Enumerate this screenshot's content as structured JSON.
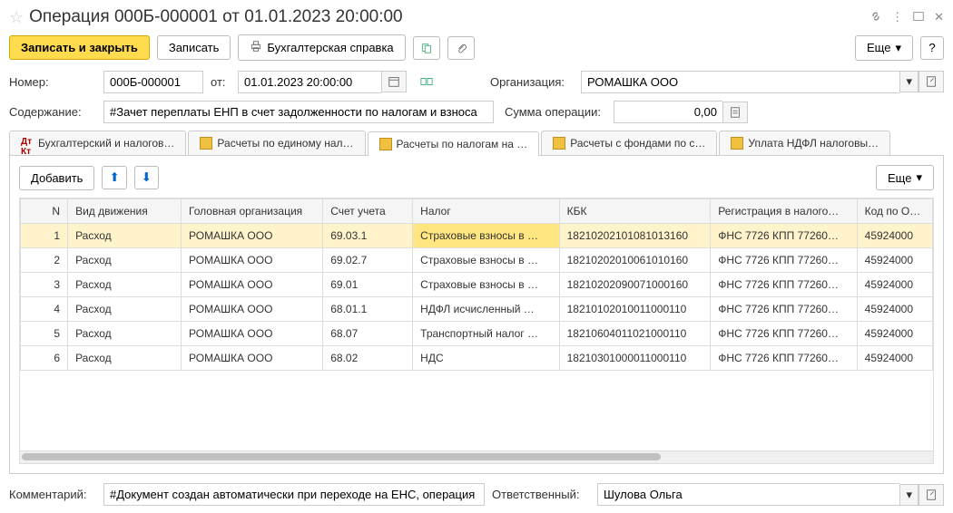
{
  "title": "Операция 000Б-000001 от 01.01.2023 20:00:00",
  "toolbar": {
    "save_close": "Записать и закрыть",
    "save": "Записать",
    "acc_ref": "Бухгалтерская справка",
    "more": "Еще"
  },
  "form": {
    "number_label": "Номер:",
    "number_value": "000Б-000001",
    "from_label": "от:",
    "date_value": "01.01.2023 20:00:00",
    "org_label": "Организация:",
    "org_value": "РОМАШКА ООО",
    "content_label": "Содержание:",
    "content_value": "#Зачет переплаты ЕНП в счет задолженности по налогам и взноса",
    "sum_label": "Сумма операции:",
    "sum_value": "0,00"
  },
  "tabs": [
    {
      "label": "Бухгалтерский и налогов…"
    },
    {
      "label": "Расчеты по единому нал…"
    },
    {
      "label": "Расчеты по налогам на …"
    },
    {
      "label": "Расчеты с фондами по с…"
    },
    {
      "label": "Уплата НДФЛ налоговы…"
    }
  ],
  "panel": {
    "add": "Добавить",
    "more": "Еще"
  },
  "table": {
    "cols": [
      "N",
      "Вид движения",
      "Головная организация",
      "Счет учета",
      "Налог",
      "КБК",
      "Регистрация в налого…",
      "Код по ОК…"
    ],
    "rows": [
      {
        "n": "1",
        "move": "Расход",
        "org": "РОМАШКА ООО",
        "acct": "69.03.1",
        "tax": "Страховые взносы в …",
        "kbk": "18210202101081013160",
        "reg": "ФНС 7726 КПП 77260…",
        "ok": "45924000"
      },
      {
        "n": "2",
        "move": "Расход",
        "org": "РОМАШКА ООО",
        "acct": "69.02.7",
        "tax": "Страховые взносы в …",
        "kbk": "18210202010061010160",
        "reg": "ФНС 7726 КПП 77260…",
        "ok": "45924000"
      },
      {
        "n": "3",
        "move": "Расход",
        "org": "РОМАШКА ООО",
        "acct": "69.01",
        "tax": "Страховые взносы в …",
        "kbk": "18210202090071000160",
        "reg": "ФНС 7726 КПП 77260…",
        "ok": "45924000"
      },
      {
        "n": "4",
        "move": "Расход",
        "org": "РОМАШКА ООО",
        "acct": "68.01.1",
        "tax": "НДФЛ исчисленный …",
        "kbk": "18210102010011000110",
        "reg": "ФНС 7726 КПП 77260…",
        "ok": "45924000"
      },
      {
        "n": "5",
        "move": "Расход",
        "org": "РОМАШКА ООО",
        "acct": "68.07",
        "tax": "Транспортный налог …",
        "kbk": "18210604011021000110",
        "reg": "ФНС 7726 КПП 77260…",
        "ok": "45924000"
      },
      {
        "n": "6",
        "move": "Расход",
        "org": "РОМАШКА ООО",
        "acct": "68.02",
        "tax": "НДС",
        "kbk": "18210301000011000110",
        "reg": "ФНС 7726 КПП 77260…",
        "ok": "45924000"
      }
    ]
  },
  "footer": {
    "comment_label": "Комментарий:",
    "comment_value": "#Документ создан автоматически при переходе на ЕНС, операция",
    "resp_label": "Ответственный:",
    "resp_value": "Шулова Ольга"
  }
}
